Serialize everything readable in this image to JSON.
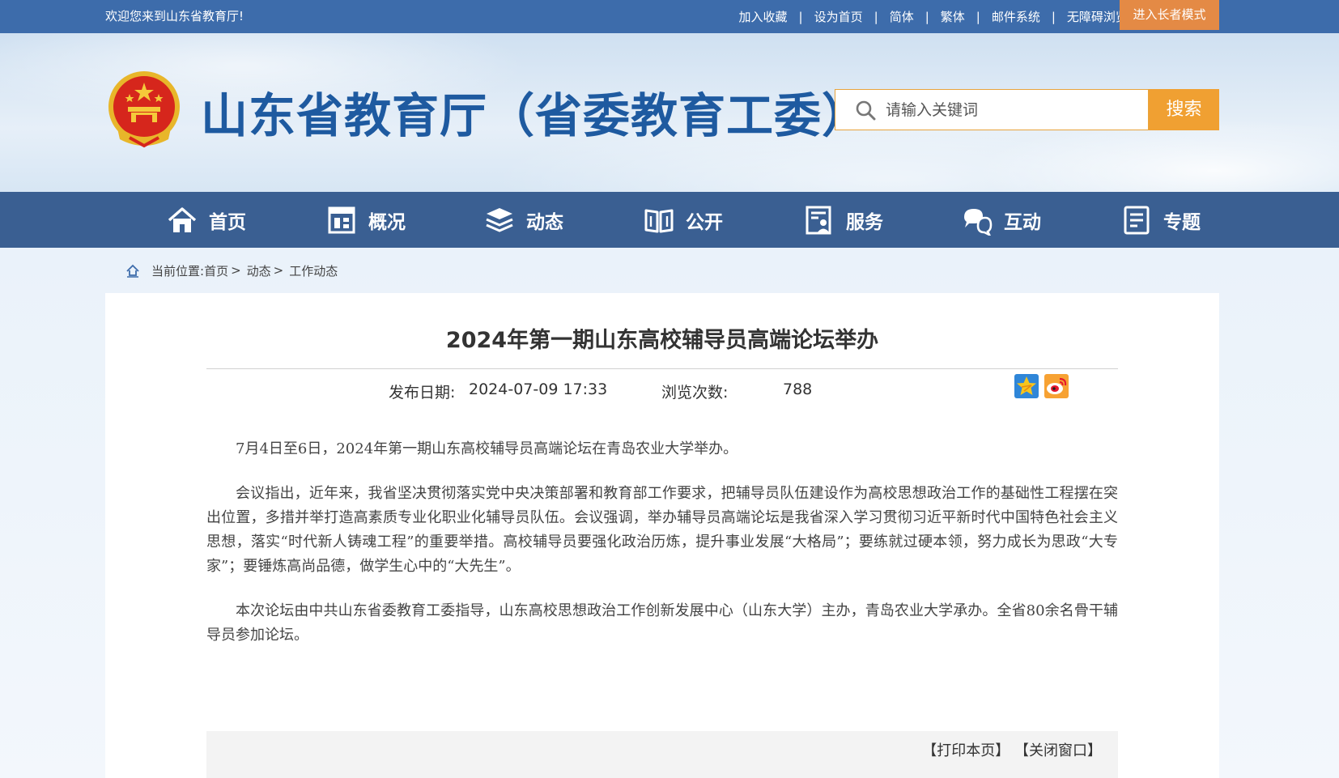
{
  "topbar": {
    "welcome": "欢迎您来到山东省教育厅!",
    "links": [
      "加入收藏",
      "设为首页",
      "简体",
      "繁体",
      "邮件系统",
      "无障碍浏览"
    ],
    "separator": "|",
    "elder_mode": "进入长者模式"
  },
  "header": {
    "site_title": "山东省教育厅（省委教育工委）",
    "search_placeholder": "请输入关键词",
    "search_button": "搜索"
  },
  "nav": {
    "items": [
      {
        "label": "首页",
        "icon": "home-icon"
      },
      {
        "label": "概况",
        "icon": "overview-icon"
      },
      {
        "label": "动态",
        "icon": "news-stack-icon"
      },
      {
        "label": "公开",
        "icon": "open-book-icon"
      },
      {
        "label": "服务",
        "icon": "service-icon"
      },
      {
        "label": "互动",
        "icon": "chat-bubbles-icon"
      },
      {
        "label": "专题",
        "icon": "document-list-icon"
      }
    ]
  },
  "breadcrumb": {
    "prefix": "当前位置:",
    "items": [
      "首页",
      "动态",
      "工作动态"
    ],
    "separator": ">"
  },
  "article": {
    "title": "2024年第一期山东高校辅导员高端论坛举办",
    "date_label": "发布日期:",
    "date_value": "2024-07-09 17:33",
    "views_label": "浏览次数:",
    "views_value": "788",
    "share_icons": [
      "qzone-star-icon",
      "weibo-icon"
    ],
    "paragraphs": [
      "7月4日至6日，2024年第一期山东高校辅导员高端论坛在青岛农业大学举办。",
      "会议指出，近年来，我省坚决贯彻落实党中央决策部署和教育部工作要求，把辅导员队伍建设作为高校思想政治工作的基础性工程摆在突出位置，多措并举打造高素质专业化职业化辅导员队伍。会议强调，举办辅导员高端论坛是我省深入学习贯彻习近平新时代中国特色社会主义思想，落实“时代新人铸魂工程”的重要举措。高校辅导员要强化政治历炼，提升事业发展“大格局”；要练就过硬本领，努力成长为思政“大专家”；要锤炼高尚品德，做学生心中的“大先生”。",
      "本次论坛由中共山东省委教育工委指导，山东高校思想政治工作创新发展中心（山东大学）主办，青岛农业大学承办。全省80余名骨干辅导员参加论坛。"
    ]
  },
  "footer": {
    "print": "【打印本页】",
    "close": "【关闭窗口】"
  },
  "colors": {
    "topbar": "#3d6cab",
    "nav": "#3a5f92",
    "accent_orange": "#f0a032",
    "title_blue": "#1e5aa0"
  }
}
